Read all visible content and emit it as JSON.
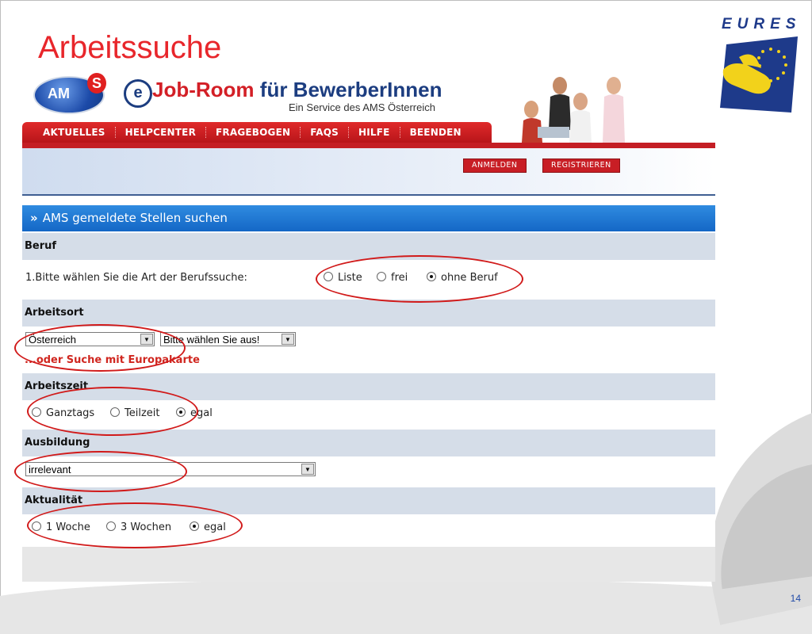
{
  "slide": {
    "title": "Arbeitssuche",
    "page_number": "14"
  },
  "eures": {
    "text": "EURES"
  },
  "banner": {
    "ams_logo_text": "AM",
    "ams_logo_s": "S",
    "e_badge": "e",
    "title_part1": "Job-Room",
    "title_part2": "für BewerberInnen",
    "subtitle": "Ein Service des AMS Österreich"
  },
  "nav": {
    "items": [
      "AKTUELLES",
      "HELPCENTER",
      "FRAGEBOGEN",
      "FAQS",
      "HILFE",
      "BEENDEN"
    ]
  },
  "login": {
    "anmelden": "ANMELDEN",
    "registrieren": "REGISTRIEREN"
  },
  "form": {
    "header": "AMS gemeldete Stellen suchen",
    "header_icon": "double-chevron-right",
    "beruf": {
      "label": "Beruf",
      "question": "1.Bitte wählen Sie die Art der Berufssuche:",
      "options": [
        "Liste",
        "frei",
        "ohne Beruf"
      ],
      "selected": "ohne Beruf"
    },
    "arbeitsort": {
      "label": "Arbeitsort",
      "country_value": "Österreich",
      "region_value": "Bitte wählen Sie aus!",
      "map_link": "...oder Suche mit Europakarte"
    },
    "arbeitszeit": {
      "label": "Arbeitszeit",
      "options": [
        "Ganztags",
        "Teilzeit",
        "egal"
      ],
      "selected": "egal"
    },
    "ausbildung": {
      "label": "Ausbildung",
      "value": "irrelevant"
    },
    "aktualitaet": {
      "label": "Aktualität",
      "options": [
        "1 Woche",
        "3 Wochen",
        "egal"
      ],
      "selected": "egal"
    }
  },
  "colors": {
    "title_red": "#e8262b",
    "nav_red": "#c41e24",
    "header_blue": "#1467c6",
    "row_grey": "#d5dde8",
    "annotation_red": "#d11a1a"
  }
}
